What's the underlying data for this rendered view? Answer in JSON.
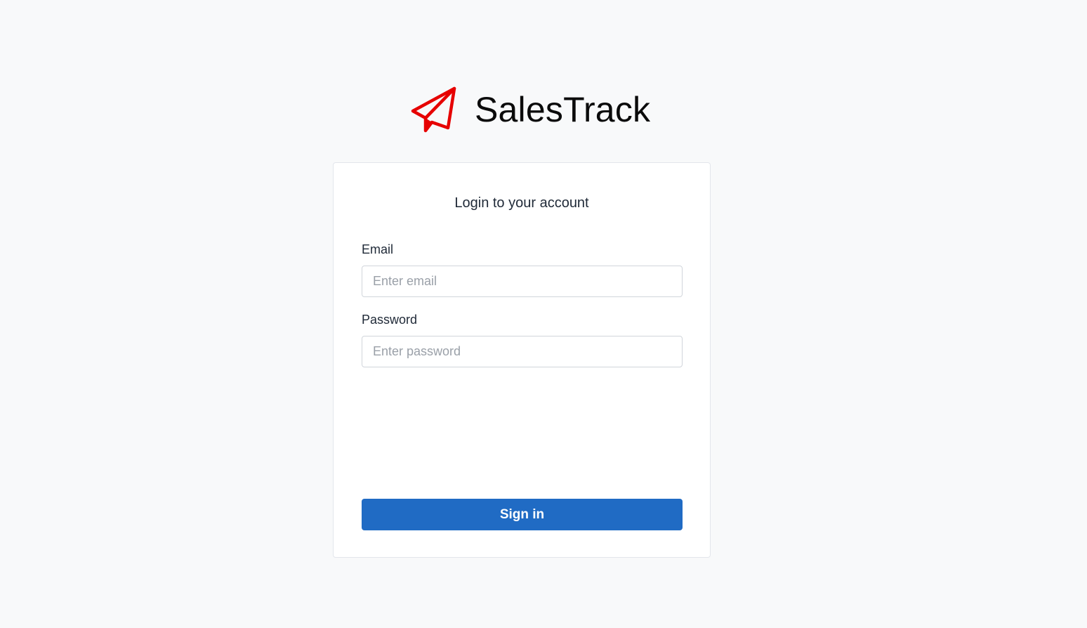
{
  "brand": {
    "name": "SalesTrack",
    "logo_icon": "paper-plane-icon",
    "logo_color": "#e60000"
  },
  "login": {
    "title": "Login to your account",
    "email_label": "Email",
    "email_placeholder": "Enter email",
    "email_value": "",
    "password_label": "Password",
    "password_placeholder": "Enter password",
    "password_value": "",
    "submit_label": "Sign in"
  },
  "colors": {
    "page_background": "#f8f9fa",
    "card_background": "#ffffff",
    "primary_button": "#206bc4"
  }
}
